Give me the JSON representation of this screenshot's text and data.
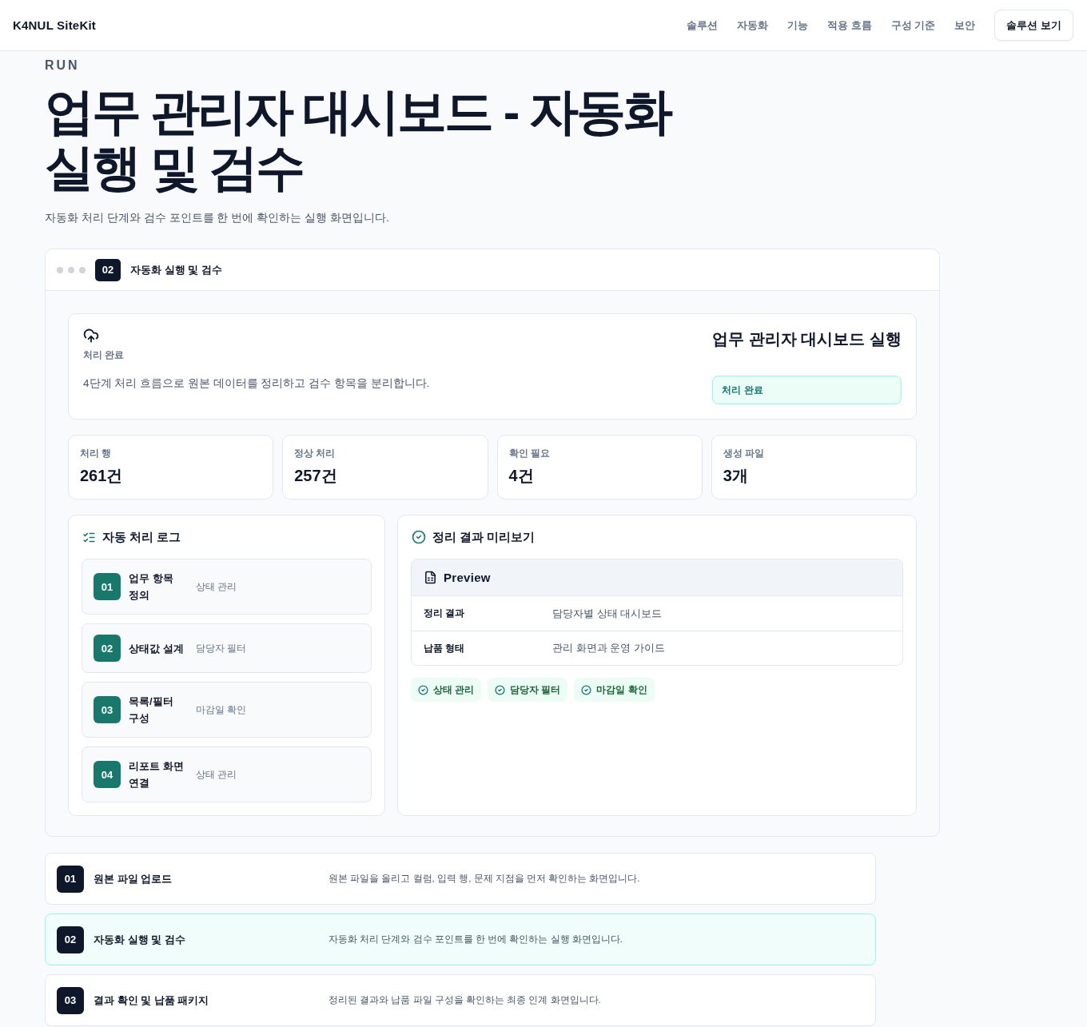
{
  "header": {
    "logo": "K4NUL SiteKit",
    "nav": [
      "솔루션",
      "자동화",
      "기능",
      "적용 흐름",
      "구성 기준",
      "보안"
    ],
    "cta": "솔루션 보기"
  },
  "hero": {
    "eyebrow": "RUN",
    "title": "업무 관리자 대시보드 - 자동화 실행 및 검수",
    "subtitle": "자동화 처리 단계와 검수 포인트를 한 번에 확인하는 실행 화면입니다."
  },
  "frame": {
    "badge": "02",
    "title": "자동화 실행 및 검수"
  },
  "summary": {
    "label": "처리 완료",
    "description": "4단계 처리 흐름으로 원본 데이터를 정리하고 검수 항목을 분리합니다.",
    "title": "업무 관리자 대시보드 실행",
    "status": "처리 완료"
  },
  "stats": [
    {
      "label": "처리 행",
      "value": "261건"
    },
    {
      "label": "정상 처리",
      "value": "257건"
    },
    {
      "label": "확인 필요",
      "value": "4건"
    },
    {
      "label": "생성 파일",
      "value": "3개"
    }
  ],
  "log": {
    "title": "자동 처리 로그",
    "steps": [
      {
        "number": "01",
        "title": "업무 항목 정의",
        "tag": "상태 관리"
      },
      {
        "number": "02",
        "title": "상태값 설계",
        "tag": "담당자 필터"
      },
      {
        "number": "03",
        "title": "목록/필터 구성",
        "tag": "마감일 확인"
      },
      {
        "number": "04",
        "title": "리포트 화면 연결",
        "tag": "상태 관리"
      }
    ]
  },
  "preview": {
    "title": "정리 결과 미리보기",
    "table_title": "Preview",
    "rows": [
      {
        "label": "정리 결과",
        "value": "담당자별 상태 대시보드"
      },
      {
        "label": "납품 형태",
        "value": "관리 화면과 운영 가이드"
      }
    ],
    "chips": [
      "상태 관리",
      "담당자 필터",
      "마감일 확인"
    ]
  },
  "stages": [
    {
      "number": "01",
      "title": "원본 파일 업로드",
      "description": "원본 파일을 올리고 컬럼, 입력 행, 문제 지점을 먼저 확인하는 화면입니다.",
      "selected": false
    },
    {
      "number": "02",
      "title": "자동화 실행 및 검수",
      "description": "자동화 처리 단계와 검수 포인트를 한 번에 확인하는 실행 화면입니다.",
      "selected": true
    },
    {
      "number": "03",
      "title": "결과 확인 및 납품 패키지",
      "description": "정리된 결과와 납품 파일 구성을 확인하는 최종 인계 화면입니다.",
      "selected": false
    }
  ]
}
